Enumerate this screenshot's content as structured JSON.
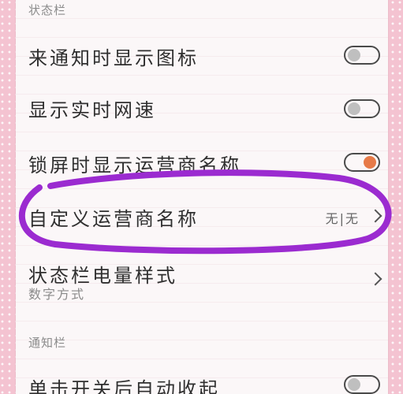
{
  "sections": {
    "status_bar": "状态栏",
    "notification_bar": "通知栏"
  },
  "rows": {
    "notification_icons": {
      "title": "来通知时显示图标",
      "toggle_on": false
    },
    "realtime_speed": {
      "title": "显示实时网速",
      "toggle_on": false
    },
    "lockscreen_carrier": {
      "title": "锁屏时显示运营商名称",
      "toggle_on": true
    },
    "custom_carrier_name": {
      "title": "自定义运营商名称",
      "value": "无|无"
    },
    "battery_style": {
      "title": "状态栏电量样式",
      "subtitle": "数字方式"
    },
    "auto_collapse": {
      "title": "单击开关后自动收起",
      "toggle_on": false
    }
  },
  "colors": {
    "toggle_on": "#e77a48",
    "annotation": "#9b2bd0"
  }
}
